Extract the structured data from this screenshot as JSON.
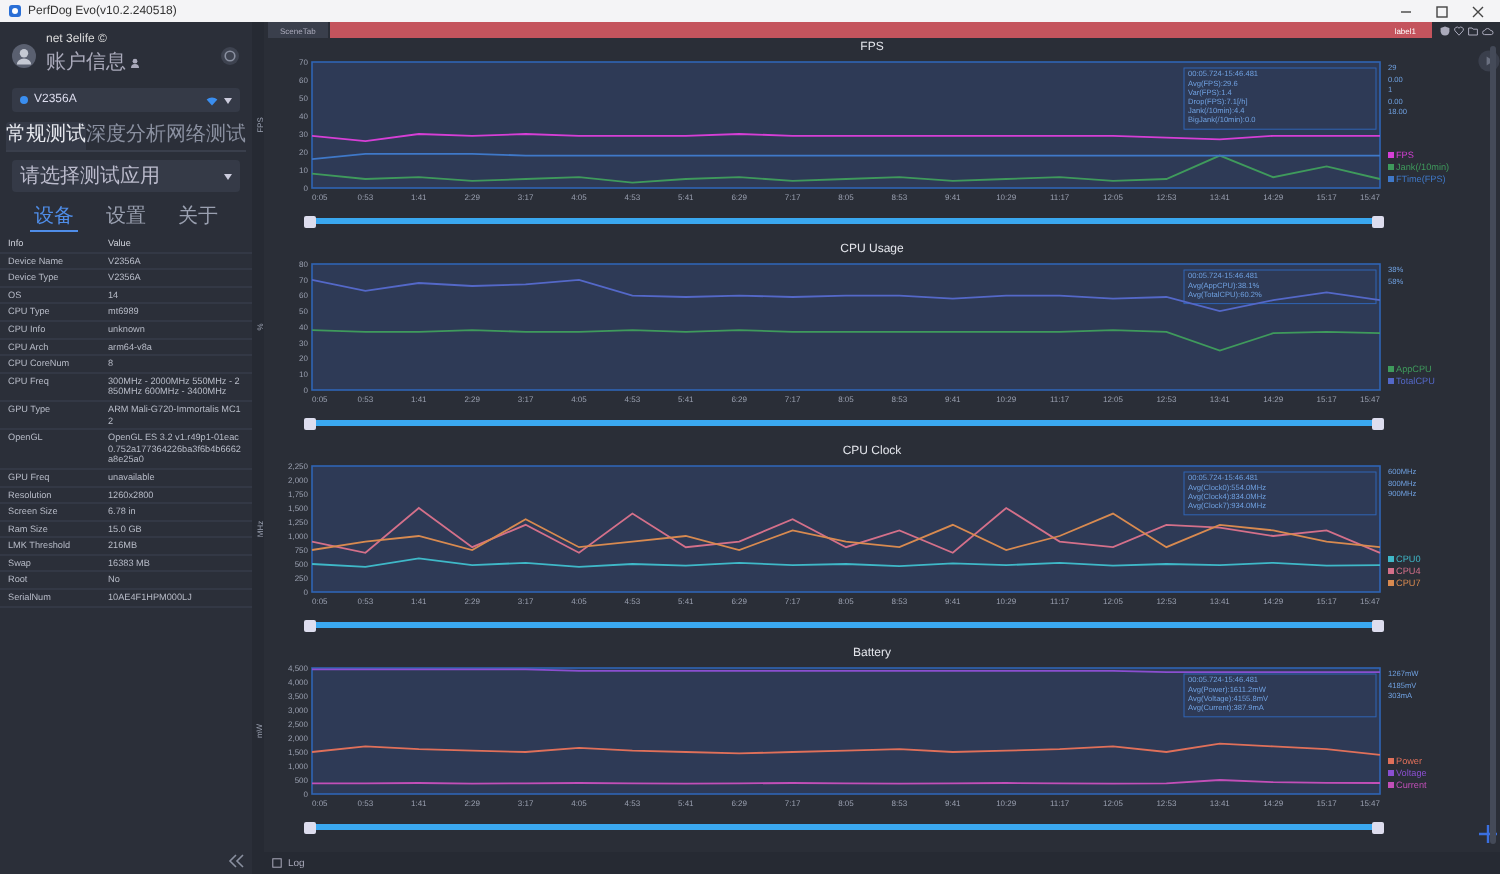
{
  "window": {
    "title": "PerfDog Evo(v10.2.240518)"
  },
  "account": {
    "user": "net 3elife ©",
    "link": "账户信息"
  },
  "device": {
    "name": "V2356A"
  },
  "mode_tabs": [
    {
      "label": "常规测试",
      "selected": true
    },
    {
      "label": "深度分析",
      "selected": false
    },
    {
      "label": "网络测试",
      "selected": false
    }
  ],
  "app_select": {
    "placeholder": "请选择测试应用"
  },
  "info_tabs": [
    {
      "label": "设备",
      "selected": true
    },
    {
      "label": "设置",
      "selected": false
    },
    {
      "label": "关于",
      "selected": false
    }
  ],
  "info_table": {
    "columns": [
      "Info",
      "Value"
    ],
    "rows": [
      [
        "Device Name",
        "V2356A"
      ],
      [
        "Device Type",
        "V2356A"
      ],
      [
        "OS",
        "14"
      ],
      [
        "CPU Type",
        "mt6989"
      ],
      [
        "CPU Info",
        "unknown"
      ],
      [
        "CPU Arch",
        "arm64-v8a"
      ],
      [
        "CPU CoreNum",
        "8"
      ],
      [
        "CPU Freq",
        "300MHz - 2000MHz 550MHz - 2850MHz 600MHz - 3400MHz"
      ],
      [
        "GPU Type",
        "ARM Mali-G720-Immortalis MC12"
      ],
      [
        "OpenGL",
        "OpenGL ES 3.2 v1.r49p1-01eac0.752a177364226ba3f6b4b6662a8e25a0"
      ],
      [
        "GPU Freq",
        "unavailable"
      ],
      [
        "Resolution",
        "1260x2800"
      ],
      [
        "Screen Size",
        "6.78 in"
      ],
      [
        "Ram Size",
        "15.0 GB"
      ],
      [
        "LMK Threshold",
        "216MB"
      ],
      [
        "Swap",
        "16383 MB"
      ],
      [
        "Root",
        "No"
      ],
      [
        "SerialNum",
        "10AE4F1HPM000LJ"
      ]
    ]
  },
  "scene_tabs": [
    {
      "label": "SceneTab",
      "selected": false
    },
    {
      "label": "label1",
      "selected": true
    }
  ],
  "charts": [
    {
      "title": "FPS",
      "axis_label": "FPS",
      "slider": {
        "level": 1
      },
      "summary": [
        "00:05.724-15:46.481",
        "Avg(FPS):29.6",
        "Var(FPS):1.4",
        "Drop(FPS):7.1[/h]",
        "Jank(/10min):4.4",
        "BigJank(/10min):0.0"
      ],
      "readings": [
        "29",
        "0.00",
        "1",
        "0.00",
        "18.00"
      ],
      "chart_data": {
        "type": "line",
        "categories": [
          "0:05",
          "0:53",
          "1:41",
          "2:29",
          "3:17",
          "4:05",
          "4:53",
          "5:41",
          "6:29",
          "7:17",
          "8:05",
          "8:53",
          "9:41",
          "10:29",
          "11:17",
          "12:05",
          "12:53",
          "13:41",
          "14:29",
          "15:17",
          "15:47"
        ],
        "ylim": [
          0,
          70
        ],
        "yticks": [
          0,
          10,
          20,
          30,
          40,
          50,
          60,
          70
        ],
        "series": [
          {
            "name": "FPS",
            "color": "#d63fd6",
            "values": [
              29,
              26,
              30,
              29,
              30,
              29,
              29,
              29,
              30,
              29,
              29,
              29,
              29,
              29,
              29,
              29,
              28,
              27,
              29,
              29,
              29
            ]
          },
          {
            "name": "Jank(/10min)",
            "color": "#3f9a5c",
            "values": [
              8,
              5,
              6,
              4,
              5,
              6,
              3,
              5,
              6,
              4,
              5,
              6,
              4,
              5,
              6,
              4,
              5,
              18,
              6,
              12,
              5
            ]
          },
          {
            "name": "FTime(FPS)",
            "color": "#3f78c8",
            "values": [
              16,
              19,
              19,
              19,
              18,
              18,
              18,
              18,
              18,
              18,
              18,
              18,
              18,
              18,
              18,
              18,
              18,
              18,
              18,
              18,
              18
            ]
          }
        ]
      }
    },
    {
      "title": "CPU Usage",
      "axis_label": "%",
      "slider": {
        "level": 1
      },
      "summary": [
        "00:05.724-15:46.481",
        "Avg(AppCPU):38.1%",
        "Avg(TotalCPU):60.2%"
      ],
      "readings": [
        "38%",
        "58%"
      ],
      "chart_data": {
        "type": "line",
        "categories": [
          "0:05",
          "0:53",
          "1:41",
          "2:29",
          "3:17",
          "4:05",
          "4:53",
          "5:41",
          "6:29",
          "7:17",
          "8:05",
          "8:53",
          "9:41",
          "10:29",
          "11:17",
          "12:05",
          "12:53",
          "13:41",
          "14:29",
          "15:17",
          "15:47"
        ],
        "ylim": [
          0,
          80
        ],
        "yticks": [
          0,
          10,
          20,
          30,
          40,
          50,
          60,
          70,
          80
        ],
        "series": [
          {
            "name": "AppCPU",
            "color": "#3f9a5c",
            "values": [
              38,
              37,
              37,
              38,
              37,
              37,
              38,
              37,
              38,
              37,
              37,
              37,
              37,
              37,
              37,
              38,
              37,
              25,
              36,
              37,
              36
            ]
          },
          {
            "name": "TotalCPU",
            "color": "#5468c8",
            "values": [
              70,
              63,
              68,
              66,
              67,
              70,
              60,
              59,
              60,
              59,
              60,
              60,
              58,
              60,
              60,
              58,
              59,
              50,
              57,
              62,
              57
            ]
          }
        ]
      }
    },
    {
      "title": "CPU Clock",
      "axis_label": "MHz",
      "slider": {
        "level": 1
      },
      "summary": [
        "00:05.724-15:46.481",
        "Avg(Clock0):554.0MHz",
        "Avg(Clock4):834.0MHz",
        "Avg(Clock7):934.0MHz"
      ],
      "readings": [
        "600MHz",
        "800MHz",
        "900MHz"
      ],
      "chart_data": {
        "type": "line",
        "categories": [
          "0:05",
          "0:53",
          "1:41",
          "2:29",
          "3:17",
          "4:05",
          "4:53",
          "5:41",
          "6:29",
          "7:17",
          "8:05",
          "8:53",
          "9:41",
          "10:29",
          "11:17",
          "12:05",
          "12:53",
          "13:41",
          "14:29",
          "15:17",
          "15:47"
        ],
        "ylim": [
          0,
          2250
        ],
        "yticks": [
          {
            "value": 0,
            "label": "0"
          },
          {
            "value": 250,
            "label": "250"
          },
          {
            "value": 500,
            "label": "500"
          },
          {
            "value": 750,
            "label": "750"
          },
          {
            "value": 1000,
            "label": "1,000"
          },
          {
            "value": 1250,
            "label": "1,250"
          },
          {
            "value": 1500,
            "label": "1,500"
          },
          {
            "value": 1750,
            "label": "1,750"
          },
          {
            "value": 2000,
            "label": "2,000"
          },
          {
            "value": 2250,
            "label": "2,250"
          }
        ],
        "series": [
          {
            "name": "CPU0",
            "color": "#3fb8c8",
            "values": [
              500,
              450,
              600,
              480,
              520,
              450,
              500,
              470,
              520,
              480,
              500,
              460,
              510,
              480,
              520,
              470,
              500,
              480,
              520,
              470,
              480
            ]
          },
          {
            "name": "CPU4",
            "color": "#d4708a",
            "values": [
              900,
              700,
              1500,
              800,
              1200,
              700,
              1400,
              800,
              900,
              1300,
              800,
              1100,
              700,
              1500,
              900,
              800,
              1200,
              1150,
              1000,
              1100,
              700
            ]
          },
          {
            "name": "CPU7",
            "color": "#d88a50",
            "values": [
              750,
              900,
              1000,
              750,
              1300,
              800,
              900,
              1000,
              750,
              1100,
              900,
              800,
              1200,
              750,
              1000,
              1400,
              800,
              1200,
              1100,
              900,
              800
            ]
          }
        ]
      }
    },
    {
      "title": "Battery",
      "axis_label": "mW",
      "slider": {
        "level": 1
      },
      "summary": [
        "00:05.724-15:46.481",
        "Avg(Power):1611.2mW",
        "Avg(Voltage):4155.8mV",
        "Avg(Current):387.9mA"
      ],
      "readings": [
        "1267mW",
        "4185mV",
        "303mA"
      ],
      "chart_data": {
        "type": "line",
        "categories": [
          "0:05",
          "0:53",
          "1:41",
          "2:29",
          "3:17",
          "4:05",
          "4:53",
          "5:41",
          "6:29",
          "7:17",
          "8:05",
          "8:53",
          "9:41",
          "10:29",
          "11:17",
          "12:05",
          "12:53",
          "13:41",
          "14:29",
          "15:17",
          "15:47"
        ],
        "ylim": [
          0,
          4500
        ],
        "yticks": [
          {
            "value": 0,
            "label": "0"
          },
          {
            "value": 500,
            "label": "500"
          },
          {
            "value": 1000,
            "label": "1,000"
          },
          {
            "value": 1500,
            "label": "1,500"
          },
          {
            "value": 2000,
            "label": "2,000"
          },
          {
            "value": 2500,
            "label": "2,500"
          },
          {
            "value": 3000,
            "label": "3,000"
          },
          {
            "value": 3500,
            "label": "3,500"
          },
          {
            "value": 4000,
            "label": "4,000"
          },
          {
            "value": 4500,
            "label": "4,500"
          }
        ],
        "series": [
          {
            "name": "Power",
            "color": "#e0705a",
            "values": [
              1500,
              1700,
              1600,
              1550,
              1500,
              1650,
              1550,
              1500,
              1450,
              1500,
              1550,
              1600,
              1500,
              1550,
              1600,
              1700,
              1500,
              1800,
              1700,
              1600,
              1400
            ]
          },
          {
            "name": "Voltage",
            "color": "#8a4fd0",
            "values": [
              4450,
              4450,
              4450,
              4450,
              4450,
              4400,
              4400,
              4400,
              4400,
              4400,
              4400,
              4400,
              4400,
              4400,
              4400,
              4400,
              4350,
              4350,
              4350,
              4350,
              4350
            ]
          },
          {
            "name": "Current",
            "color": "#c24fb8",
            "values": [
              380,
              380,
              390,
              370,
              380,
              390,
              380,
              370,
              380,
              390,
              380,
              370,
              380,
              390,
              380,
              370,
              380,
              500,
              420,
              400,
              390
            ]
          }
        ]
      }
    }
  ],
  "bottom_bar": {
    "log": "Log"
  }
}
